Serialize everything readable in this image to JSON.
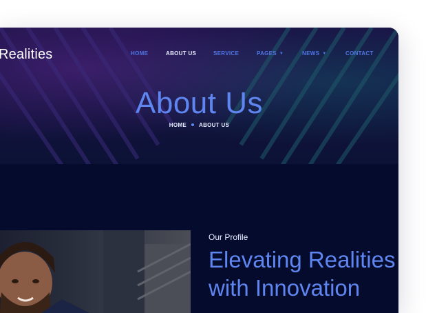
{
  "header": {
    "brand": "Realities",
    "nav": [
      {
        "label": "HOME",
        "active": false,
        "has_dropdown": false
      },
      {
        "label": "ABOUT US",
        "active": true,
        "has_dropdown": false
      },
      {
        "label": "SERVICE",
        "active": false,
        "has_dropdown": false
      },
      {
        "label": "PAGES",
        "active": false,
        "has_dropdown": true
      },
      {
        "label": "NEWS",
        "active": false,
        "has_dropdown": true
      },
      {
        "label": "CONTACT",
        "active": false,
        "has_dropdown": false
      }
    ],
    "caret_icon": "chevron-down-icon"
  },
  "hero": {
    "title": "About Us",
    "breadcrumb": {
      "home": "HOME",
      "current": "ABOUT US"
    }
  },
  "profile": {
    "label": "Our Profile",
    "heading_line1": "Elevating Realities",
    "heading_line2": "with Innovation",
    "image": "man-in-suit-photo"
  },
  "colors": {
    "background": "#050b2c",
    "accent": "#5f86f0",
    "nav_link": "#4f76e6",
    "text_light": "#e6eaff"
  }
}
